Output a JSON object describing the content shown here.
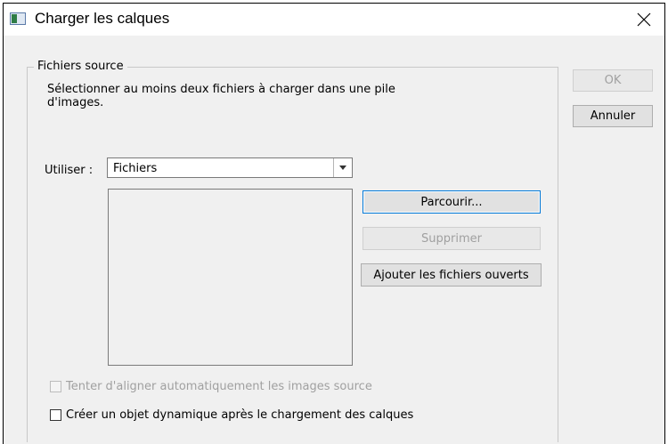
{
  "window": {
    "title": "Charger les calques"
  },
  "source_group": {
    "legend": "Fichiers source",
    "description_line1": "Sélectionner au moins deux fichiers à charger dans une pile",
    "description_line2": "d'images.",
    "use_label": "Utiliser :",
    "use_selected": "Fichiers",
    "file_list": []
  },
  "buttons": {
    "browse": "Parcourir...",
    "remove": "Supprimer",
    "add_open": "Ajouter les fichiers ouverts",
    "ok": "OK",
    "cancel": "Annuler"
  },
  "options": {
    "auto_align": {
      "label": "Tenter d'aligner automatiquement les images source",
      "checked": false,
      "enabled": false
    },
    "smart_object": {
      "label": "Créer un objet dynamique après le chargement des calques",
      "checked": false,
      "enabled": true
    }
  },
  "icons": {
    "app": "dialog-app-icon",
    "close": "close-icon",
    "dropdown": "chevron-down-icon"
  }
}
